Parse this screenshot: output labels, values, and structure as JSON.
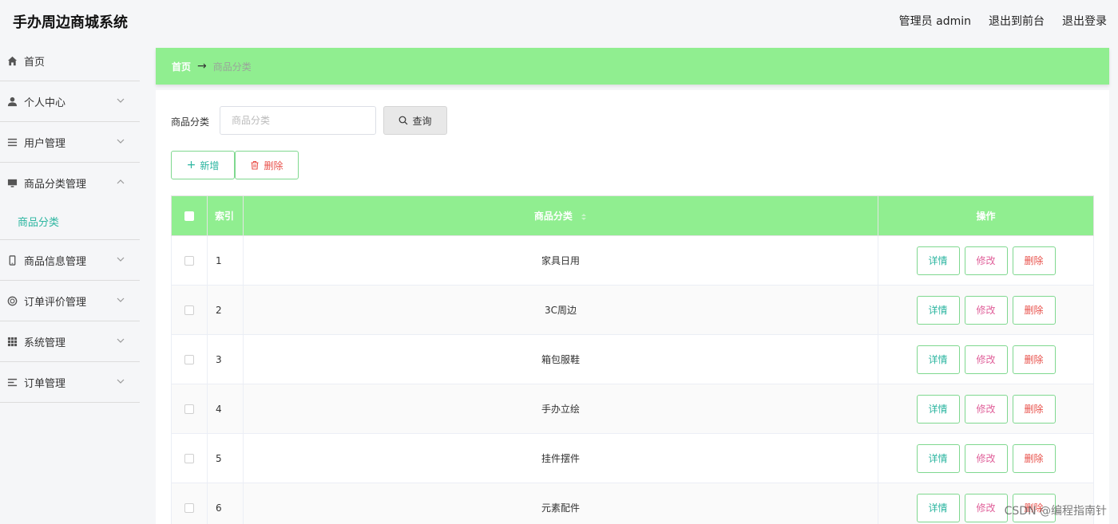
{
  "app": {
    "title": "手办周边商城系统"
  },
  "top_links": {
    "admin": "管理员 admin",
    "front": "退出到前台",
    "logout": "退出登录"
  },
  "sidebar": {
    "items": [
      {
        "label": "首页",
        "icon": "home-icon"
      },
      {
        "label": "个人中心",
        "icon": "user-icon"
      },
      {
        "label": "用户管理",
        "icon": "list-icon"
      },
      {
        "label": "商品分类管理",
        "icon": "monitor-icon",
        "expanded": true
      },
      {
        "label": "商品信息管理",
        "icon": "phone-icon"
      },
      {
        "label": "订单评价管理",
        "icon": "circle-icon"
      },
      {
        "label": "系统管理",
        "icon": "grid-icon"
      },
      {
        "label": "订单管理",
        "icon": "menu-icon"
      }
    ],
    "sub_item": "商品分类"
  },
  "breadcrumb": {
    "home": "首页",
    "arrow": "→",
    "current": "商品分类"
  },
  "search": {
    "label": "商品分类",
    "placeholder": "商品分类",
    "button": "查询"
  },
  "actions": {
    "add": "新增",
    "delete": "删除"
  },
  "table": {
    "headers": {
      "index": "索引",
      "name": "商品分类",
      "ops": "操作"
    },
    "rows": [
      {
        "index": "1",
        "name": "家具日用"
      },
      {
        "index": "2",
        "name": "3C周边"
      },
      {
        "index": "3",
        "name": "箱包服鞋"
      },
      {
        "index": "4",
        "name": "手办立绘"
      },
      {
        "index": "5",
        "name": "挂件摆件"
      },
      {
        "index": "6",
        "name": "元素配件"
      }
    ],
    "op_labels": {
      "detail": "详情",
      "edit": "修改",
      "delete": "删除"
    }
  },
  "watermark": "CSDN @编程指南针",
  "colors": {
    "accent": "#90ee90",
    "teal": "#2bb5a0",
    "pink": "#e0609a",
    "red": "#e8504a"
  }
}
